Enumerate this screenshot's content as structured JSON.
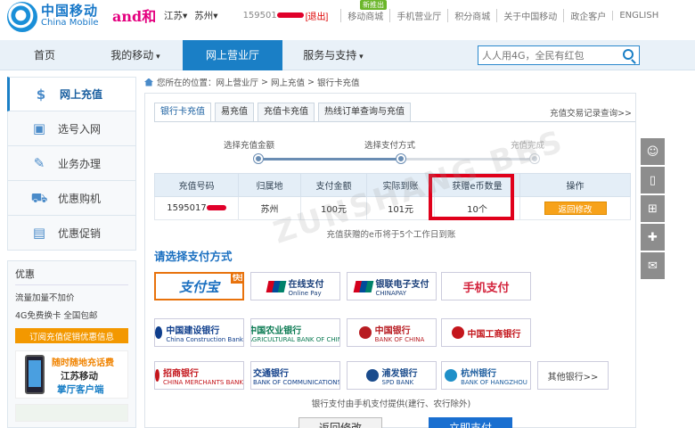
{
  "top": {
    "logo_cn": "中国移动",
    "logo_en": "China Mobile",
    "and_brand": "and",
    "and_suffix": "和",
    "province": "江苏",
    "city": "苏州",
    "phone_prefix": "159501",
    "logout": "[退出]",
    "new_badge": "新推出",
    "links": [
      "移动商城",
      "手机营业厅",
      "积分商城",
      "关于中国移动",
      "政企客户",
      "ENGLISH"
    ]
  },
  "nav": {
    "items": [
      "首页",
      "我的移动",
      "网上营业厅",
      "服务与支持"
    ],
    "search_placeholder": "人人用4G，全民有红包"
  },
  "sidebar": {
    "items": [
      "网上充值",
      "选号入网",
      "业务办理",
      "优惠购机",
      "优惠促销"
    ],
    "promo_title": "优惠",
    "promo_lines": [
      "流量加量不加价",
      "4G免费换卡 全国包邮"
    ],
    "promo_button": "订阅充值促销优惠信息",
    "app_ad": {
      "line1": "随时随地充话费",
      "line2": "江苏移动",
      "line3": "掌厅客户端"
    }
  },
  "breadcrumb": {
    "prefix": "您所在的位置：",
    "items": [
      "网上营业厅",
      "网上充值",
      "银行卡充值"
    ]
  },
  "tabs": {
    "items": [
      "银行卡充值",
      "易充值",
      "充值卡充值",
      "热线订单查询与充值"
    ],
    "record_link": "充值交易记录查询>>"
  },
  "steps": [
    "选择充值金额",
    "选择支付方式",
    "充值完成"
  ],
  "order_table": {
    "headers": [
      "充值号码",
      "归属地",
      "支付金额",
      "实际到账",
      "获赠e币数量",
      "操作"
    ],
    "row": {
      "phone": "1595017",
      "location": "苏州",
      "pay": "100元",
      "actual": "101元",
      "ecoin": "10个",
      "action": "返回修改"
    }
  },
  "ecoin_note": "充值获赠的e币将于5个工作日到账",
  "payment": {
    "title": "请选择支付方式",
    "methods": [
      {
        "name": "支付宝",
        "tag": "快捷"
      },
      {
        "name": "在线支付",
        "sub": "Online Pay",
        "brand": "UnionPay"
      },
      {
        "name": "银联电子支付",
        "sub": "CHINAPAY",
        "brand": "UnionPay"
      },
      {
        "name": "手机支付"
      }
    ],
    "banks": [
      {
        "name": "中国建设银行",
        "sub": "China Construction Bank"
      },
      {
        "name": "中国农业银行",
        "sub": "AGRICULTURAL BANK OF CHINA"
      },
      {
        "name": "中国银行",
        "sub": "BANK OF CHINA"
      },
      {
        "name": "中国工商银行"
      },
      {
        "name": "招商银行",
        "sub": "CHINA MERCHANTS BANK"
      },
      {
        "name": "交通银行",
        "sub": "BANK OF COMMUNICATIONS"
      },
      {
        "name": "浦发银行",
        "sub": "SPD BANK"
      },
      {
        "name": "杭州银行",
        "sub": "BANK OF HANGZHOU"
      },
      {
        "name": "其他银行>>"
      }
    ],
    "note": "银行支付由手机支付提供(建行、农行除外)",
    "back_button": "返回修改",
    "pay_button": "立即支付"
  },
  "watermark": "ZUNSHANG BBS",
  "colors": {
    "primary": "#1a7fc6",
    "orange": "#f39800",
    "highlight": "#e0001b"
  },
  "icons": [
    "recharge-icon",
    "sim-icon",
    "edit-icon",
    "cart-icon",
    "sell-icon",
    "search-icon",
    "home-icon",
    "chat-icon",
    "phone-icon",
    "sitemap-icon",
    "gift-icon",
    "feedback-icon"
  ]
}
